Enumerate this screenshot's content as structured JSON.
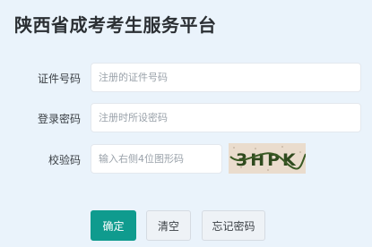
{
  "page": {
    "title": "陕西省成考考生服务平台"
  },
  "form": {
    "id_number": {
      "label": "证件号码",
      "placeholder": "注册的证件号码",
      "value": ""
    },
    "password": {
      "label": "登录密码",
      "placeholder": "注册时所设密码",
      "value": ""
    },
    "captcha": {
      "label": "校验码",
      "placeholder": "输入右侧4位图形码",
      "value": "",
      "image_text": "3HPK"
    }
  },
  "buttons": {
    "confirm": "确定",
    "clear": "清空",
    "forgot_password": "忘记密码"
  },
  "colors": {
    "background": "#eaf3fb",
    "primary": "#0f9b8e",
    "title": "#2b2f33"
  }
}
